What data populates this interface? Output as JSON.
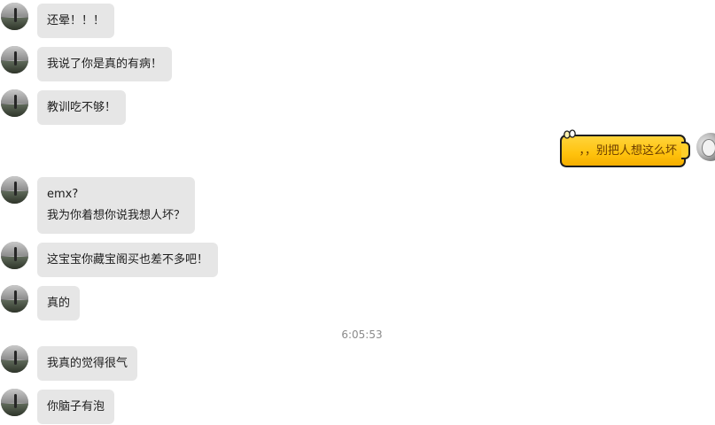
{
  "messages": [
    {
      "text": "还晕！！！"
    },
    {
      "text": "我说了你是真的有病！"
    },
    {
      "text": "教训吃不够！"
    },
    {
      "text": "，，别把人想这么坏"
    },
    {
      "lines": [
        "emx?",
        "我为你着想你说我想人坏？"
      ]
    },
    {
      "text": "这宝宝你藏宝阁买也差不多吧！"
    },
    {
      "text": "真的"
    },
    {
      "timestamp": "6:05:53"
    },
    {
      "text": "我真的觉得很气"
    },
    {
      "text": "你脑子有泡"
    }
  ],
  "colors": {
    "incoming_bubble": "#e6e6e6",
    "outgoing_bubble": "#ffc20d",
    "outgoing_text": "#6a3c00",
    "timestamp_text": "#8a8a8a"
  },
  "icons": {
    "incoming_avatar": "contact-avatar",
    "outgoing_avatar": "own-avatar",
    "bubble_decoration": "ear-decoration-icon"
  }
}
